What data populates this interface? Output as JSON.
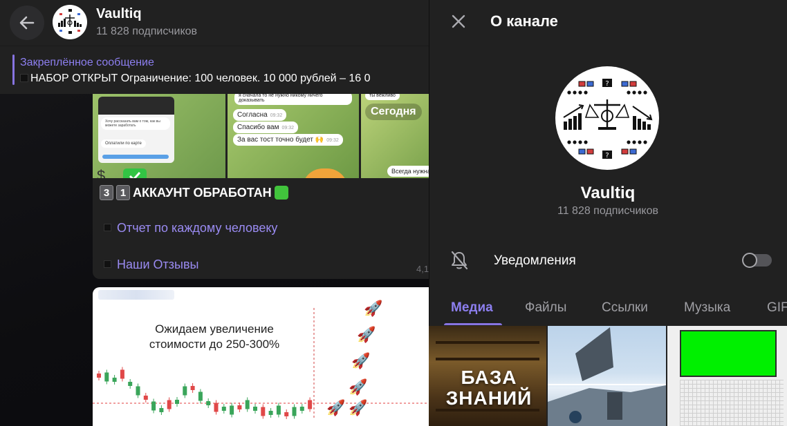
{
  "chat": {
    "title": "Vaultiq",
    "subscribers": "11 828 подписчиков",
    "pinned": {
      "label": "Закреплённое сообщение",
      "text": "НАБОР ОТКРЫТ  Ограничение: 100 человек.  10 000 рублей – 16 0"
    },
    "message1": {
      "media": {
        "tile1_bubble_top": "Хочу рассказать вам о том, как вы можете заработать",
        "tile1_bubble_pay": "Оплатили по карте",
        "tile2_bubble_top": "я сначала то не нужно никому ничего доказывать",
        "tile2_b1": "Согласна",
        "tile2_b2": "Спасибо вам",
        "tile2_b3": "За вас тост точно будет 🙌",
        "tile2_time": "09:32",
        "tile3_pill": "Сегодня",
        "tile3_bubble": "Всегда нужна",
        "tile3_top": "ты вежливо"
      },
      "heading_digit1": "3",
      "heading_digit2": "1",
      "heading_text": "АККАУНТ ОБРАБОТАН",
      "link1": "Отчет по каждому человеку",
      "link2": "Наши Отзывы",
      "views": "4,1"
    },
    "message2": {
      "caption_line1": "Ожидаем увеличение",
      "caption_line2": "стоимости до 250-300%"
    }
  },
  "panel": {
    "title": "О канале",
    "channel_name": "Vaultiq",
    "subscribers": "11 828 подписчиков",
    "notifications_label": "Уведомления",
    "notifications_on": false,
    "tabs": [
      "Медиа",
      "Файлы",
      "Ссылки",
      "Музыка",
      "GIF"
    ],
    "active_tab": "Медиа",
    "media": {
      "cell1_text_line1": "БАЗА",
      "cell1_text_line2": "ЗНАНИЙ"
    }
  },
  "colors": {
    "accent": "#8774e1",
    "link": "#9a8bf2",
    "panel_bg": "#212121",
    "muted_text": "#9a9a9f"
  },
  "icons": [
    "back-arrow-icon",
    "close-icon",
    "bell-off-icon",
    "rocket-icon",
    "money-bag-icon",
    "check-mark-icon",
    "green-square-icon",
    "black-square-icon"
  ]
}
